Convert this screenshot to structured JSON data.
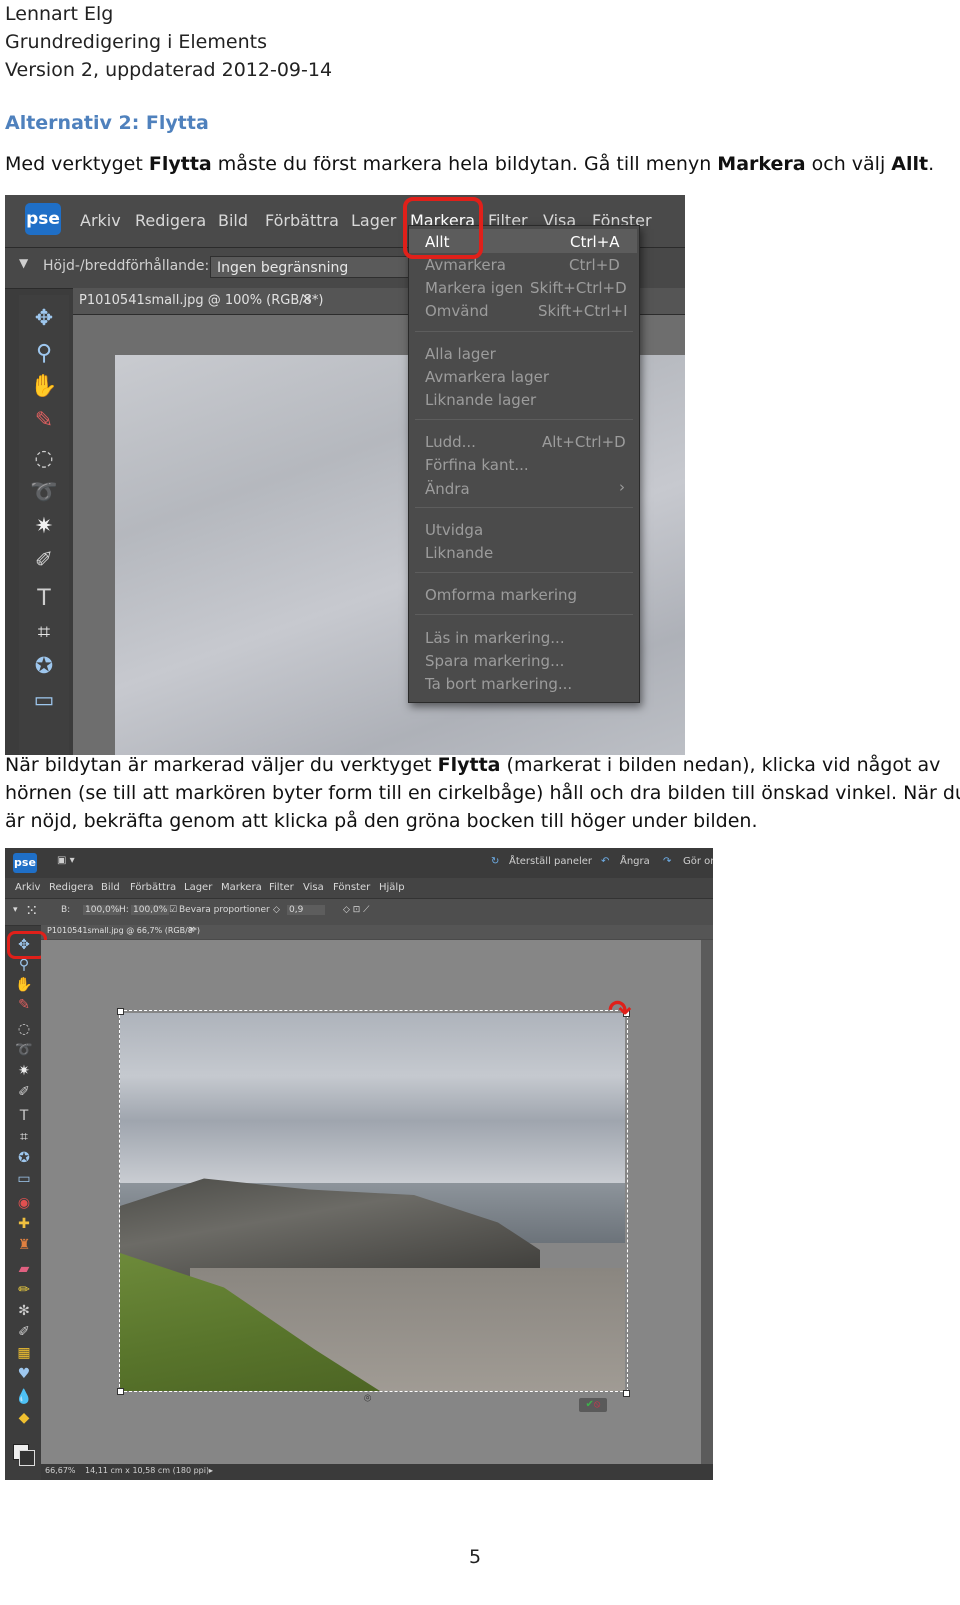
{
  "header": {
    "author": "Lennart Elg",
    "subject": "Grundredigering  i Elements",
    "version": "Version 2, uppdaterad 2012-09-14"
  },
  "section_heading": "Alternativ 2: Flytta",
  "para1": {
    "t1": "Med verktyget ",
    "b1": "Flytta",
    "t2": " måste du först markera hela bildytan. Gå till menyn ",
    "b2": "Markera",
    "t3": " och välj ",
    "b3": "Allt",
    "t4": "."
  },
  "screenshot1": {
    "logo": "pse",
    "menubar": [
      "Arkiv",
      "Redigera",
      "Bild",
      "Förbättra",
      "Lager",
      "Markera",
      "Filter",
      "Visa",
      "Fönster"
    ],
    "option_label": "Höjd-/breddförhållande:",
    "option_value": "Ingen begränsning",
    "doc_tab": "P1010541small.jpg @ 100% (RGB/8*)",
    "doc_tab_close": "×",
    "dropdown": [
      {
        "label": "Allt",
        "shortcut": "Ctrl+A"
      },
      {
        "label": "Avmarkera",
        "shortcut": "Ctrl+D"
      },
      {
        "label": "Markera igen",
        "shortcut": "Skift+Ctrl+D"
      },
      {
        "label": "Omvänd",
        "shortcut": "Skift+Ctrl+I"
      },
      {
        "label": "Alla lager",
        "shortcut": ""
      },
      {
        "label": "Avmarkera lager",
        "shortcut": ""
      },
      {
        "label": "Liknande lager",
        "shortcut": ""
      },
      {
        "label": "Ludd...",
        "shortcut": "Alt+Ctrl+D"
      },
      {
        "label": "Förfina kant...",
        "shortcut": ""
      },
      {
        "label": "Ändra",
        "shortcut": "›"
      },
      {
        "label": "Utvidga",
        "shortcut": ""
      },
      {
        "label": "Liknande",
        "shortcut": ""
      },
      {
        "label": "Omforma markering",
        "shortcut": ""
      },
      {
        "label": "Läs in markering...",
        "shortcut": ""
      },
      {
        "label": "Spara markering...",
        "shortcut": ""
      },
      {
        "label": "Ta bort markering...",
        "shortcut": ""
      }
    ]
  },
  "para2": {
    "t1": "När bildytan är markerad väljer du verktyget ",
    "b1": "Flytta",
    "t2": " (markerat i bilden nedan), klicka vid något av",
    "line2": "hörnen (se till att markören byter form till en cirkelbåge) håll och dra bilden till önskad vinkel. När du",
    "line3": "är nöjd, bekräfta genom att klicka på den gröna bocken till höger under bilden."
  },
  "screenshot2": {
    "logo": "pse",
    "top_buttons": [
      "Återställ paneler",
      "Ångra",
      "Gör om"
    ],
    "menubar": [
      "Arkiv",
      "Redigera",
      "Bild",
      "Förbättra",
      "Lager",
      "Markera",
      "Filter",
      "Visa",
      "Fönster",
      "Hjälp"
    ],
    "options": {
      "w_label": "B:",
      "w_value": "100,0%",
      "h_label": "H:",
      "h_value": "100,0%",
      "keep_proportions": "Bevara proportioner",
      "angle_value": "0,9"
    },
    "doc_tab": "P1010541small.jpg @ 66,7% (RGB/8*)",
    "doc_tab_close": "×",
    "status_zoom": "66,67%",
    "status_info": "14,11 cm x 10,58 cm (180 ppi)"
  },
  "page_number": "5",
  "colors": {
    "heading": "#4f81bd",
    "highlight_ring": "#e0201a",
    "commit": "#3cb34a",
    "cancel": "#e0304a"
  }
}
